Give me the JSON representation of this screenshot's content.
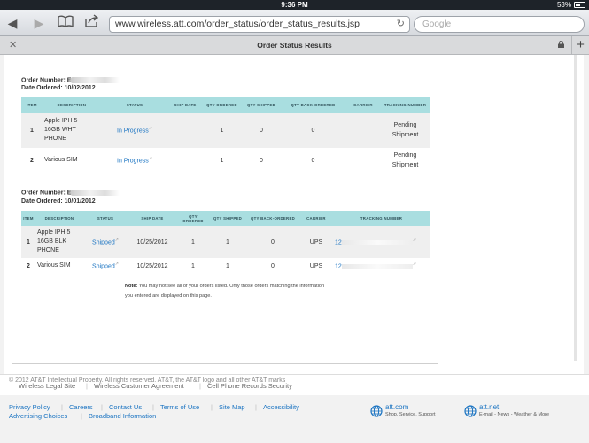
{
  "statusbar": {
    "time": "9:36 PM",
    "battery": "53%"
  },
  "browser": {
    "url": "www.wireless.att.com/order_status/order_status_results.jsp",
    "search_placeholder": "Google",
    "tab_title": "Order Status Results"
  },
  "table_headers": [
    "ITEM",
    "DESCRIPTION",
    "STATUS",
    "SHIP DATE",
    "QTY ORDERED",
    "QTY SHIPPED",
    "QTY BACK-ORDERED",
    "CARRIER",
    "TRACKING NUMBER"
  ],
  "orders": [
    {
      "number_label": "Order Number: E",
      "date_label": "Date Ordered: 10/02/2012",
      "rows": [
        {
          "item": "1",
          "description_lines": [
            "Apple IPH 5",
            "16GB WHT",
            "PHONE"
          ],
          "status": "In Progress",
          "ship_date": "",
          "qty_ordered": "1",
          "qty_shipped": "0",
          "qty_back": "0",
          "carrier": "",
          "tracking_lines": [
            "Pending",
            "Shipment"
          ]
        },
        {
          "item": "2",
          "description_lines": [
            "Various SIM"
          ],
          "status": "In Progress",
          "ship_date": "",
          "qty_ordered": "1",
          "qty_shipped": "0",
          "qty_back": "0",
          "carrier": "",
          "tracking_lines": [
            "Pending",
            "Shipment"
          ]
        }
      ]
    },
    {
      "number_label": "Order Number: E",
      "date_label": "Date Ordered: 10/01/2012",
      "rows": [
        {
          "item": "1",
          "description_lines": [
            "Apple IPH 5",
            "16GB BLK",
            "PHONE"
          ],
          "status": "Shipped",
          "ship_date": "10/25/2012",
          "qty_ordered": "1",
          "qty_shipped": "1",
          "qty_back": "0",
          "carrier": "UPS",
          "tracking": "12"
        },
        {
          "item": "2",
          "description_lines": [
            "Various SIM"
          ],
          "status": "Shipped",
          "ship_date": "10/25/2012",
          "qty_ordered": "1",
          "qty_shipped": "1",
          "qty_back": "0",
          "carrier": "UPS",
          "tracking": "12"
        }
      ]
    }
  ],
  "note": {
    "label": "Note:",
    "line1": "You may not see all of your orders listed. Only those orders matching the information",
    "line2": "you entered are displayed on this page."
  },
  "footer_bar": [
    "Wireless Legal Site",
    "Wireless Customer Agreement",
    "Cell Phone Records Security"
  ],
  "footer_links_row1": [
    "Privacy Policy",
    "Careers",
    "Contact Us",
    "Terms of Use",
    "Site Map",
    "Accessibility"
  ],
  "footer_links_row2": [
    "Advertising Choices",
    "Broadband Information"
  ],
  "brands": [
    {
      "name": "att.com",
      "tagline": "Shop. Service. Support"
    },
    {
      "name": "att.net",
      "tagline": "E-mail - News - Weather & More"
    }
  ],
  "copyright": "© 2012 AT&T Intellectual Property. All rights reserved. AT&T, the AT&T logo and all other AT&T marks"
}
